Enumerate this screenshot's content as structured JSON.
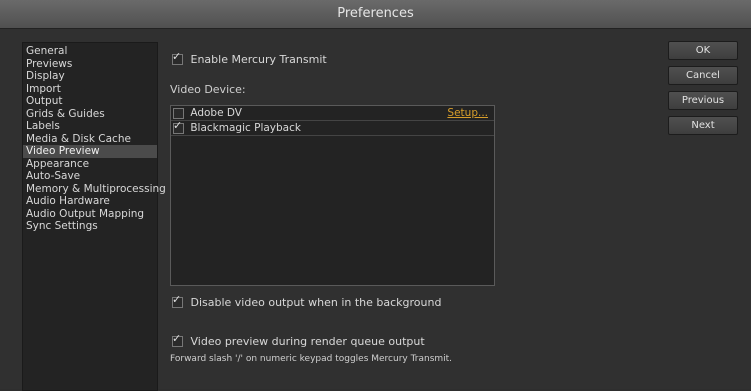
{
  "window": {
    "title": "Preferences"
  },
  "sidebar": {
    "items": [
      {
        "label": "General"
      },
      {
        "label": "Previews"
      },
      {
        "label": "Display"
      },
      {
        "label": "Import"
      },
      {
        "label": "Output"
      },
      {
        "label": "Grids & Guides"
      },
      {
        "label": "Labels"
      },
      {
        "label": "Media & Disk Cache"
      },
      {
        "label": "Video Preview"
      },
      {
        "label": "Appearance"
      },
      {
        "label": "Auto-Save"
      },
      {
        "label": "Memory & Multiprocessing"
      },
      {
        "label": "Audio Hardware"
      },
      {
        "label": "Audio Output Mapping"
      },
      {
        "label": "Sync Settings"
      }
    ],
    "selected_index": 8
  },
  "content": {
    "enable_mercury": {
      "label": "Enable Mercury Transmit",
      "checked": true
    },
    "video_device_label": "Video Device:",
    "devices": [
      {
        "label": "Adobe DV",
        "checked": false,
        "setup": "Setup..."
      },
      {
        "label": "Blackmagic Playback",
        "checked": true,
        "setup": ""
      }
    ],
    "disable_background": {
      "label": "Disable video output when in the background",
      "checked": true
    },
    "render_queue": {
      "label": "Video preview during render queue output",
      "checked": true
    },
    "note": "Forward slash '/' on numeric keypad toggles Mercury Transmit."
  },
  "buttons": {
    "ok": "OK",
    "cancel": "Cancel",
    "previous": "Previous",
    "next": "Next"
  },
  "colors": {
    "link": "#d89e2a",
    "selection": "#4b4b4b",
    "background": "#303030"
  }
}
